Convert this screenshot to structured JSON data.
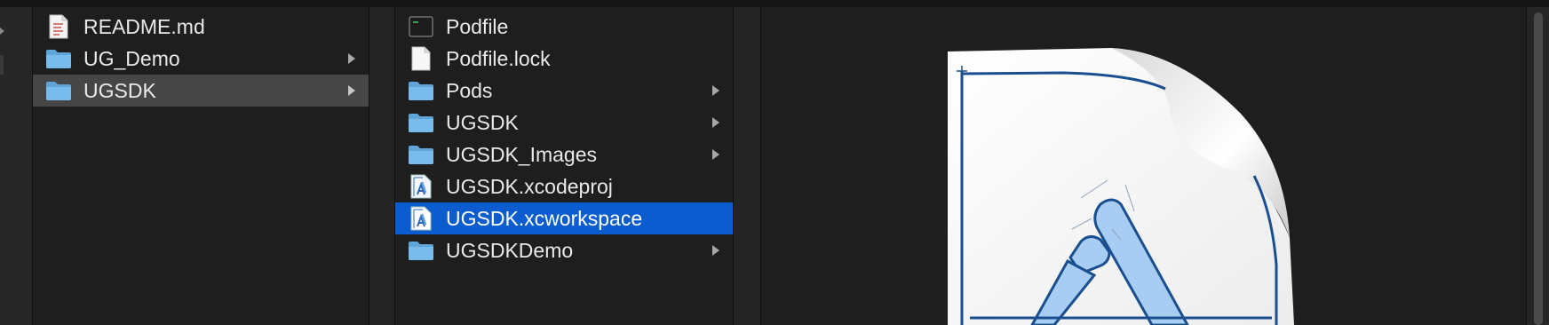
{
  "column1": {
    "items": [
      {
        "label": "README.md",
        "icon": "document-icon",
        "has_children": false,
        "selected": false
      },
      {
        "label": "UG_Demo",
        "icon": "folder-icon",
        "has_children": true,
        "selected": false
      },
      {
        "label": "UGSDK",
        "icon": "folder-icon",
        "has_children": true,
        "selected": true
      }
    ]
  },
  "column2": {
    "items": [
      {
        "label": "Podfile",
        "icon": "terminal-icon",
        "has_children": false,
        "selected": false
      },
      {
        "label": "Podfile.lock",
        "icon": "blank-document-icon",
        "has_children": false,
        "selected": false
      },
      {
        "label": "Pods",
        "icon": "folder-icon",
        "has_children": true,
        "selected": false
      },
      {
        "label": "UGSDK",
        "icon": "folder-icon",
        "has_children": true,
        "selected": false
      },
      {
        "label": "UGSDK_Images",
        "icon": "folder-icon",
        "has_children": true,
        "selected": false
      },
      {
        "label": "UGSDK.xcodeproj",
        "icon": "xcode-project-icon",
        "has_children": false,
        "selected": false
      },
      {
        "label": "UGSDK.xcworkspace",
        "icon": "xcode-workspace-icon",
        "has_children": false,
        "selected": true
      },
      {
        "label": "UGSDKDemo",
        "icon": "folder-icon",
        "has_children": true,
        "selected": false
      }
    ]
  },
  "preview": {
    "icon": "xcode-workspace-preview-icon"
  },
  "colors": {
    "background": "#1e1e1e",
    "selection_active": "#0a5ccf",
    "selection_inactive": "#464646",
    "folder_blue": "#69b3e7",
    "blueprint_stroke": "#1a4f8f"
  }
}
